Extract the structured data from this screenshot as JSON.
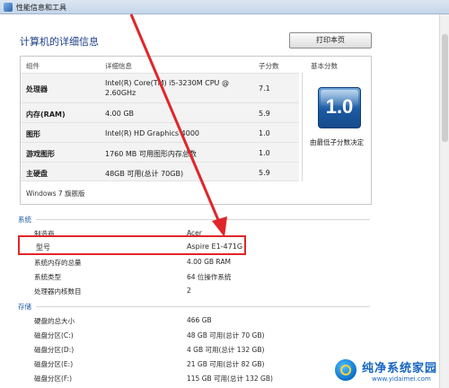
{
  "window": {
    "title": "性能信息和工具"
  },
  "page": {
    "title": "计算机的详细信息",
    "print_button": "打印本页"
  },
  "table": {
    "headers": {
      "component": "组件",
      "detail": "详细信息",
      "subscore": "子分数",
      "basescore": "基本分数"
    },
    "rows": [
      {
        "component": "处理器",
        "detail_line1": "Intel(R) Core(TM) i5-3230M CPU @",
        "detail_line2": "2.60GHz",
        "subscore": "7.1"
      },
      {
        "component": "内存(RAM)",
        "detail": "4.00 GB",
        "subscore": "5.9"
      },
      {
        "component": "图形",
        "detail": "Intel(R) HD Graphics 4000",
        "subscore": "1.0"
      },
      {
        "component": "游戏图形",
        "detail": "1760 MB 可用图形内存总数",
        "subscore": "1.0"
      },
      {
        "component": "主硬盘",
        "detail": "48GB 可用(总计 70GB)",
        "subscore": "5.9"
      }
    ],
    "base_score": "1.0",
    "base_score_caption": "由最低子分数决定",
    "windows_edition": "Windows 7 旗舰版"
  },
  "system": {
    "section_label": "系统",
    "items": [
      {
        "label": "制造商",
        "value": "Acer"
      },
      {
        "label": "型号",
        "value": "Aspire E1-471G"
      },
      {
        "label": "系统内存的总量",
        "value": "4.00 GB RAM"
      },
      {
        "label": "系统类型",
        "value": "64 位操作系统"
      },
      {
        "label": "处理器内核数目",
        "value": "2"
      }
    ]
  },
  "storage": {
    "section_label": "存储",
    "items": [
      {
        "label": "硬盘的总大小",
        "value": "466 GB"
      },
      {
        "label": "磁盘分区(C:)",
        "value": "48 GB 可用(总计 70 GB)"
      },
      {
        "label": "磁盘分区(D:)",
        "value": "4 GB 可用(总计 132 GB)"
      },
      {
        "label": "磁盘分区(E:)",
        "value": "21 GB 可用(总计 82 GB)"
      },
      {
        "label": "磁盘分区(F:)",
        "value": "115 GB 可用(总计 132 GB)"
      }
    ]
  },
  "watermark": {
    "name": "纯净系统家园",
    "url": "www.yidaimei.com"
  },
  "colors": {
    "section_blue": "#1e5aa8",
    "title_blue": "#1e3f8a",
    "highlight_red": "#e0262a",
    "tile_blue": "#1c5aa3"
  }
}
